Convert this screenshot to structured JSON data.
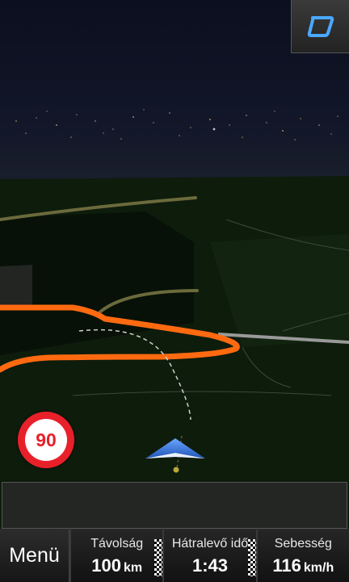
{
  "speed_limit": {
    "value": "90"
  },
  "menu": {
    "label": "Menü"
  },
  "fields": [
    {
      "label": "Távolság",
      "value": "100",
      "unit": "km"
    },
    {
      "label": "Hátralevő idő",
      "value": "1:43",
      "unit": ""
    },
    {
      "label": "Sebesség",
      "value": "116",
      "unit": "km/h"
    }
  ],
  "colors": {
    "route": "#ff6a10",
    "sky": "#0c1024",
    "land": "#0f1f0d",
    "speed_sign": "#e8202a",
    "arrow": "#2a6cd4"
  },
  "icons": {
    "view_toggle": "view-mode-icon",
    "position": "navigation-arrow-icon"
  }
}
